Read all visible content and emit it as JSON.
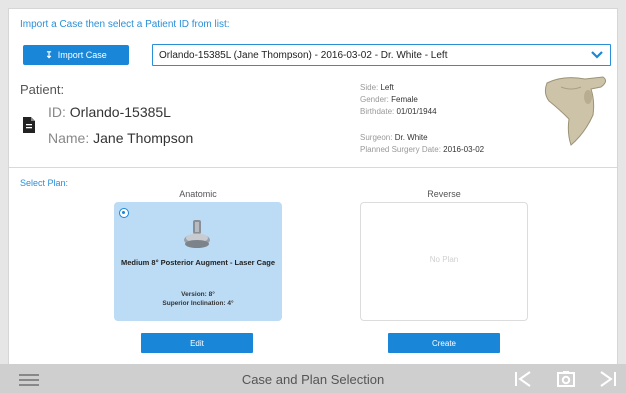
{
  "header": {
    "instruction": "Import a Case then select a Patient ID from list:",
    "import_button_label": "Import Case",
    "case_select_value": "Orlando-15385L (Jane Thompson) - 2016-03-02 - Dr. White - Left"
  },
  "patient": {
    "label": "Patient:",
    "id_label": "ID:",
    "id_value": "Orlando-15385L",
    "name_label": "Name:",
    "name_value": "Jane Thompson"
  },
  "meta": {
    "side_label": "Side:",
    "side_value": "Left",
    "gender_label": "Gender:",
    "gender_value": "Female",
    "birthdate_label": "Birthdate:",
    "birthdate_value": "01/01/1944",
    "surgeon_label": "Surgeon:",
    "surgeon_value": "Dr. White",
    "surgery_date_label": "Planned Surgery Date:",
    "surgery_date_value": "2016-03-02"
  },
  "plan": {
    "select_label": "Select Plan:",
    "anatomic": {
      "title": "Anatomic",
      "name": "Medium 8° Posterior Augment - Laser Cage",
      "version": "Version: 8°",
      "inclination": "Superior Inclination: 4°",
      "edit_label": "Edit"
    },
    "reverse": {
      "title": "Reverse",
      "placeholder": "No Plan",
      "create_label": "Create"
    }
  },
  "footer": {
    "title": "Case and Plan Selection"
  },
  "colors": {
    "accent": "#1a86d8",
    "selected_card": "#bcdcf6",
    "footer_bg": "#cfcfcf"
  },
  "icons": [
    "download-icon",
    "chevron-down-icon",
    "document-icon",
    "shoulder-bone-image",
    "implant-image",
    "menu-icon",
    "previous-icon",
    "camera-icon",
    "next-icon"
  ]
}
